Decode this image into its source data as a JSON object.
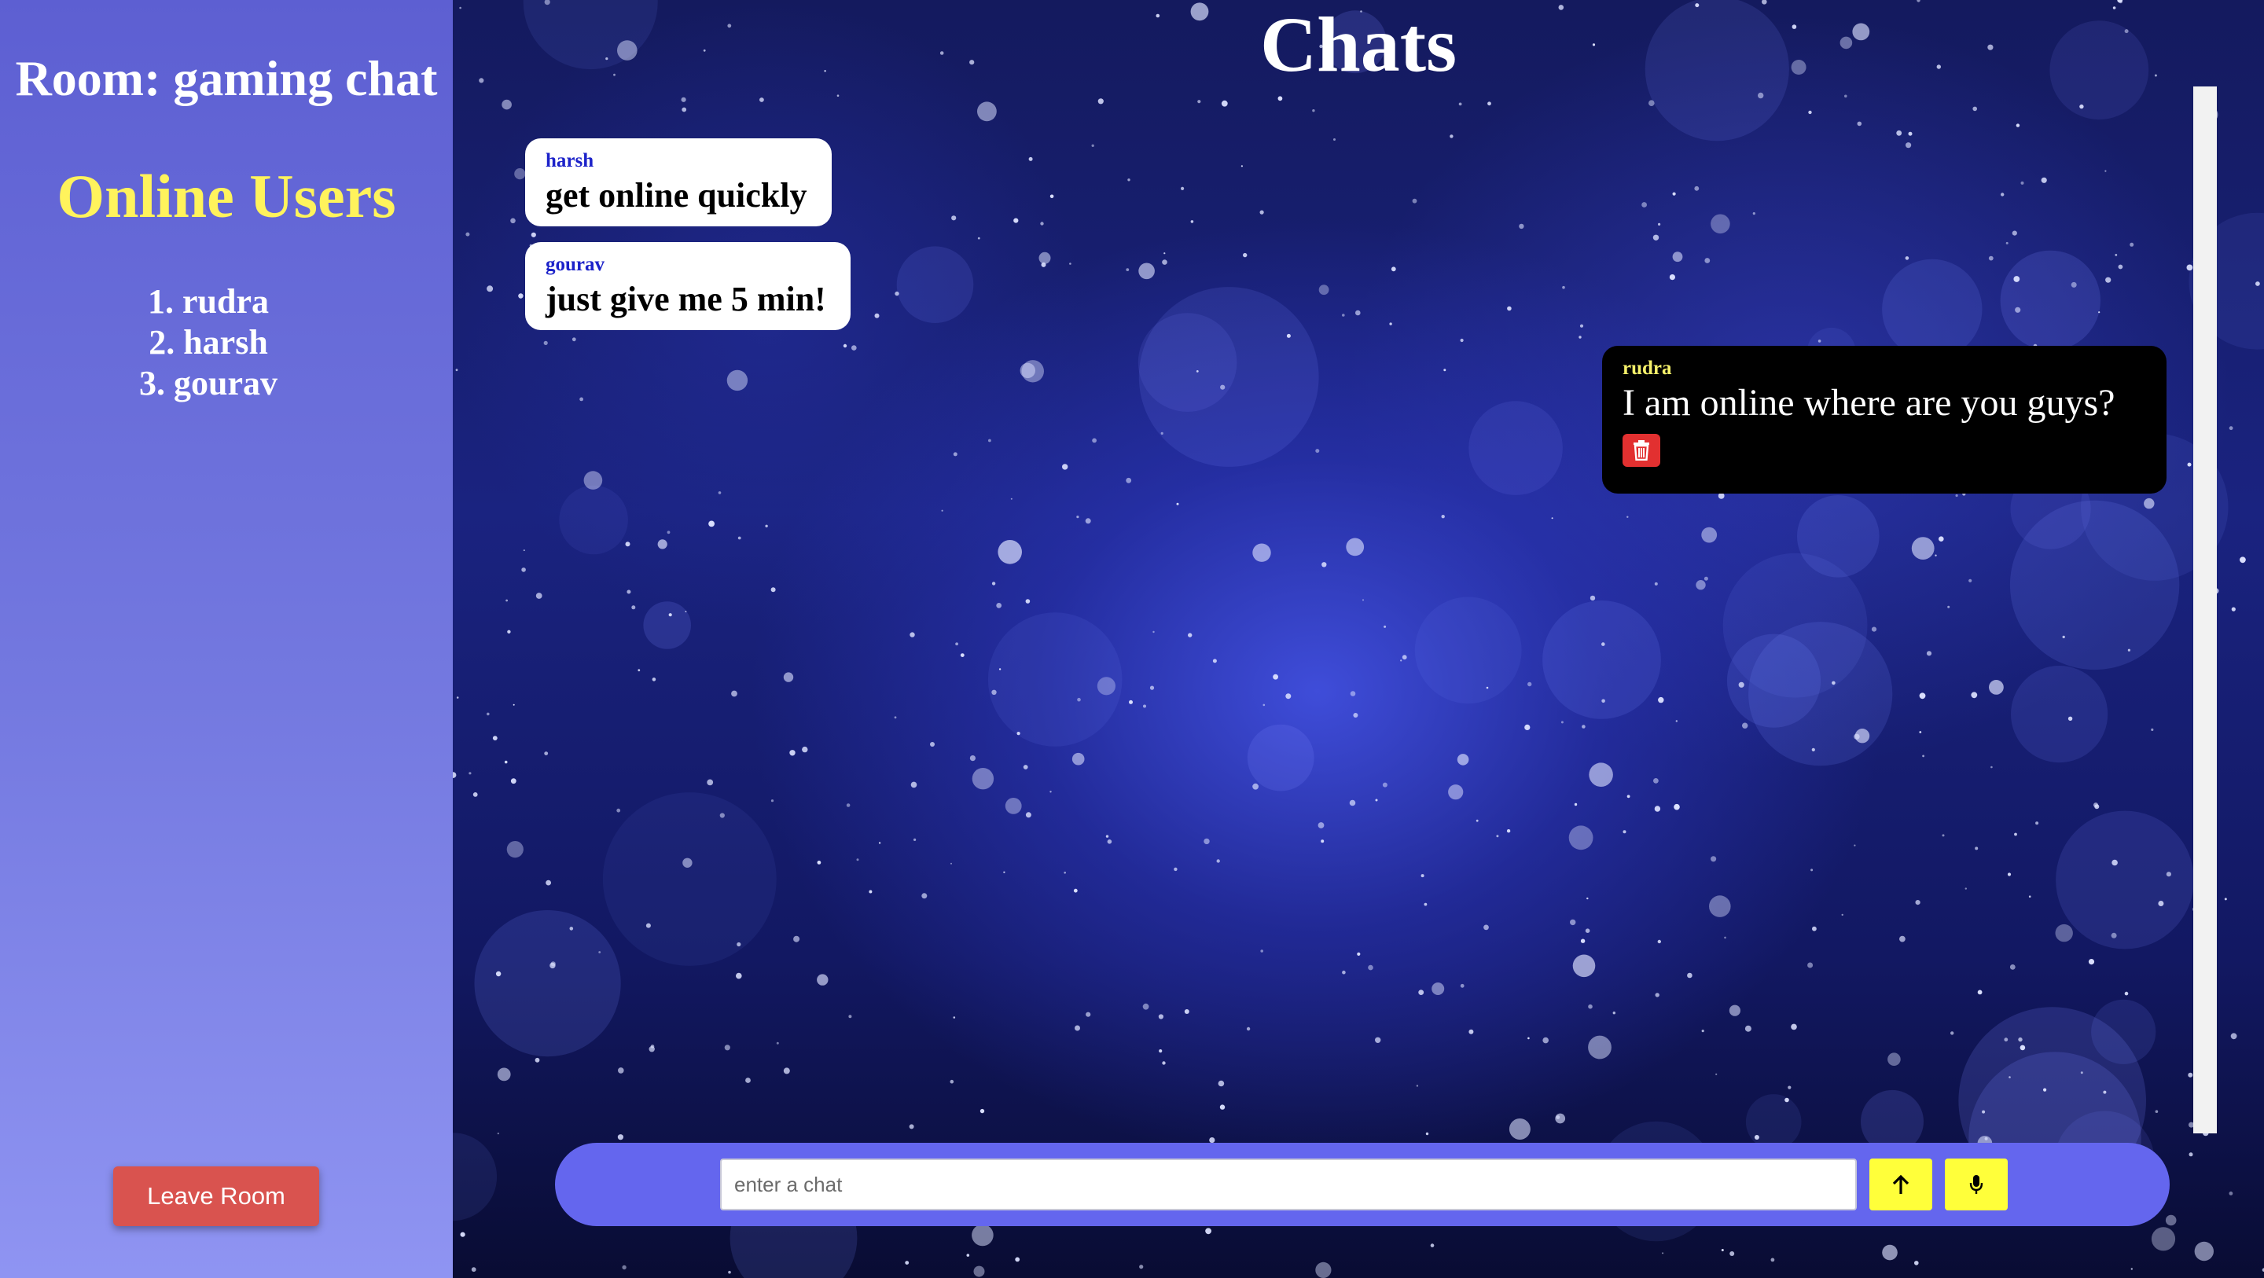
{
  "sidebar": {
    "room_title": "Room: gaming chat",
    "online_heading": "Online Users",
    "users": [
      "1. rudra",
      "2. harsh",
      "3. gourav"
    ],
    "leave_label": "Leave Room"
  },
  "chat": {
    "title": "Chats",
    "messages": [
      {
        "sender": "harsh",
        "text": "get online quickly"
      },
      {
        "sender": "gourav",
        "text": "just give me 5 min!"
      },
      {
        "sender": "rudra",
        "text": "I am online where are you guys?"
      }
    ],
    "delete_icon": "trash-icon"
  },
  "composer": {
    "placeholder": "enter a chat",
    "value": "",
    "send_icon": "arrow-up-icon",
    "mic_icon": "microphone-icon"
  },
  "colors": {
    "sidebar_top": "#5d5fd2",
    "sidebar_bottom": "#8f94f2",
    "online_heading": "#fff35c",
    "leave_button": "#d9534f",
    "composer_bar": "#6466ee",
    "action_buttons": "#ffff3a",
    "delete_button": "#e23030",
    "incoming_sender": "#1c22c9",
    "outgoing_sender": "#f5f06a"
  }
}
